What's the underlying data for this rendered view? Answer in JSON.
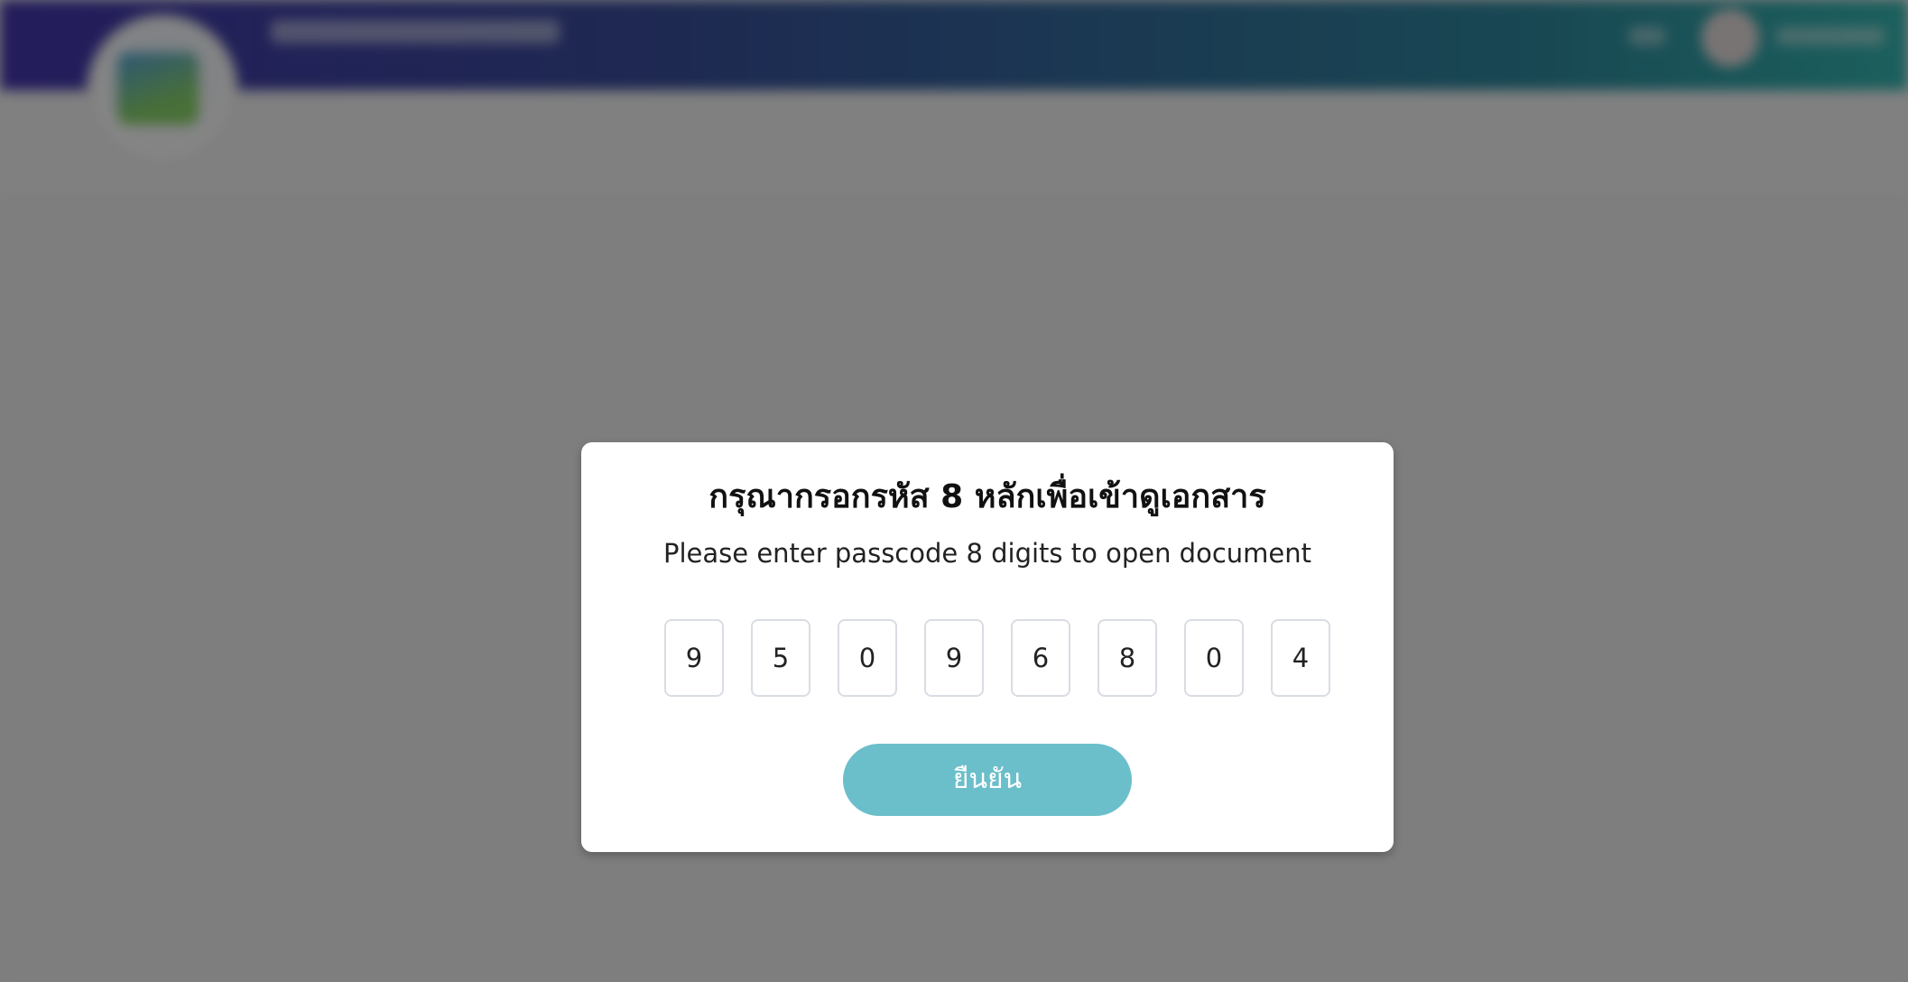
{
  "modal": {
    "title": "กรุณากรอกรหัส 8 หลักเพื่อเข้าดูเอกสาร",
    "subtitle": "Please enter passcode 8 digits to open document",
    "digits": [
      "9",
      "5",
      "0",
      "9",
      "6",
      "8",
      "0",
      "4"
    ],
    "confirm_label": "ยืนยัน"
  },
  "colors": {
    "header_gradient_start": "#4537b0",
    "header_gradient_end": "#35b8b2",
    "button": "#6bbfca",
    "overlay": "rgba(0,0,0,0.48)"
  }
}
